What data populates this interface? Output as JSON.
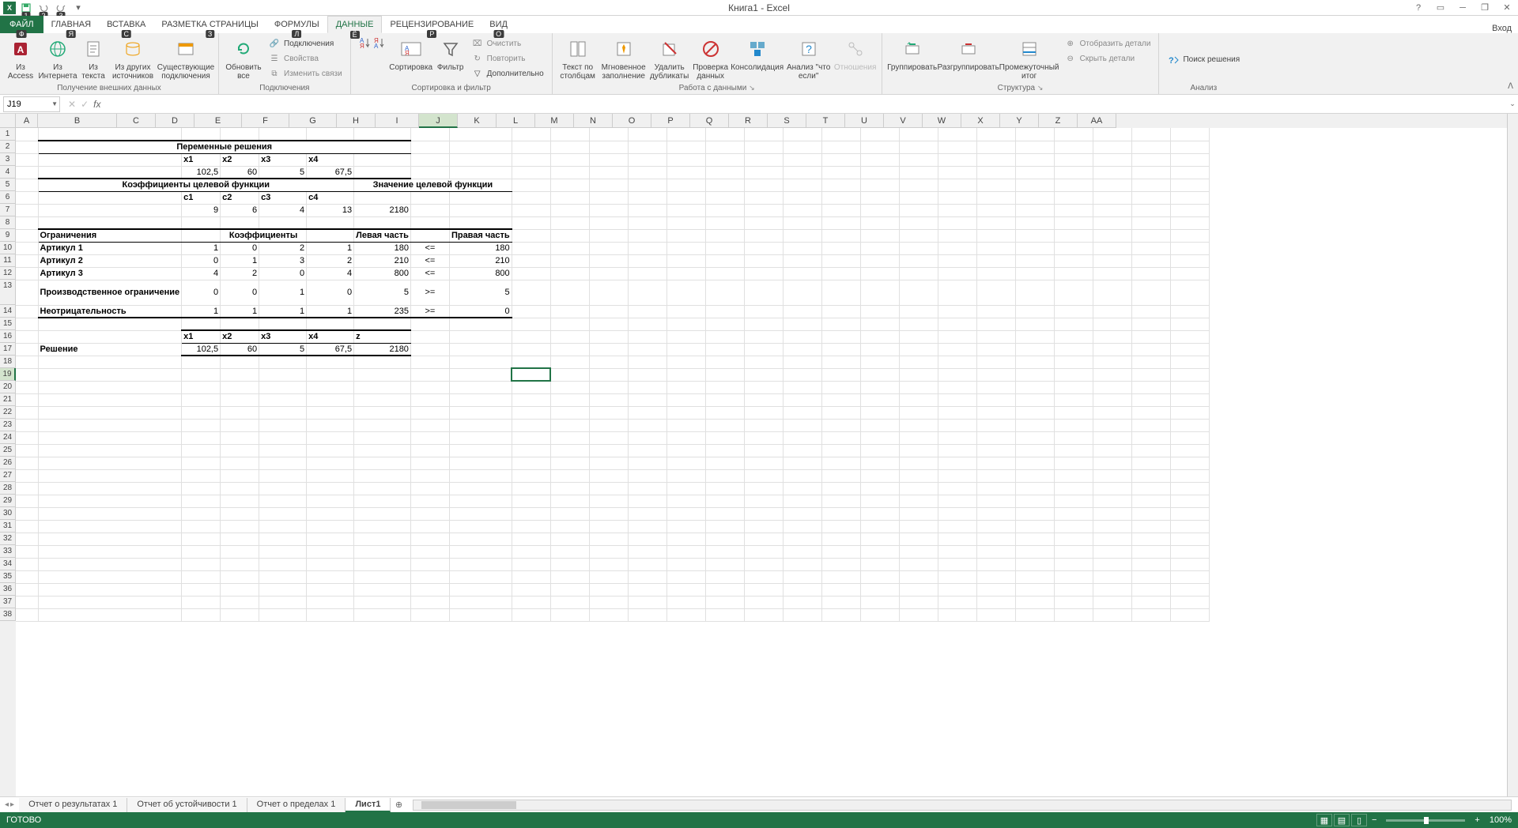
{
  "title": "Книга1 - Excel",
  "account_label": "Вход",
  "ribbon_tabs": {
    "file": "ФАЙЛ",
    "home": "ГЛАВНАЯ",
    "insert": "ВСТАВКА",
    "layout": "РАЗМЕТКА СТРАНИЦЫ",
    "formulas": "ФОРМУЛЫ",
    "data": "ДАННЫЕ",
    "review": "РЕЦЕНЗИРОВАНИЕ",
    "view": "ВИД"
  },
  "tab_keys": {
    "file": "Ф",
    "home": "Я",
    "insert": "С",
    "layout": "З",
    "formulas": "Л",
    "data": "Ё",
    "review": "Р",
    "view": "О"
  },
  "qat_keys": [
    "1",
    "2",
    "3"
  ],
  "ribbon": {
    "ext_data": {
      "access": "Из Access",
      "web": "Из Интернета",
      "text": "Из текста",
      "other": "Из других источников",
      "existing": "Существующие подключения",
      "label": "Получение внешних данных"
    },
    "connections": {
      "refresh": "Обновить все",
      "conn": "Подключения",
      "props": "Свойства",
      "edit": "Изменить связи",
      "label": "Подключения"
    },
    "sort_filter": {
      "sort": "Сортировка",
      "filter": "Фильтр",
      "clear": "Очистить",
      "reapply": "Повторить",
      "advanced": "Дополнительно",
      "label": "Сортировка и фильтр"
    },
    "tools": {
      "text_cols": "Текст по столбцам",
      "flash": "Мгновенное заполнение",
      "dup": "Удалить дубликаты",
      "valid": "Проверка данных",
      "consol": "Консолидация",
      "whatif": "Анализ \"что если\"",
      "rel": "Отношения",
      "label": "Работа с данными"
    },
    "outline": {
      "group": "Группировать",
      "ungroup": "Разгруппировать",
      "subtotal": "Промежуточный итог",
      "show": "Отобразить детали",
      "hide": "Скрыть детали",
      "label": "Структура"
    },
    "analysis": {
      "solver": "Поиск решения",
      "label": "Анализ"
    }
  },
  "name_box": "J19",
  "columns": [
    "A",
    "B",
    "C",
    "D",
    "E",
    "F",
    "G",
    "H",
    "I",
    "J",
    "K",
    "L",
    "M",
    "N",
    "O",
    "P",
    "Q",
    "R",
    "S",
    "T",
    "U",
    "V",
    "W",
    "X",
    "Y",
    "Z",
    "AA"
  ],
  "selected_col": "J",
  "selected_row": 19,
  "total_rows": 38,
  "sheet_data": {
    "title1": "Переменные решения",
    "x_headers": [
      "x1",
      "x2",
      "x3",
      "x4"
    ],
    "x_values": [
      "102,5",
      "60",
      "5",
      "67,5"
    ],
    "title2": "Коэффициенты целевой функции",
    "title3": "Значение целевой функции",
    "c_headers": [
      "c1",
      "c2",
      "c3",
      "c4"
    ],
    "c_values": [
      "9",
      "6",
      "4",
      "13"
    ],
    "obj_value": "2180",
    "constraints_title": "Ограничения",
    "coeff_title": "Коэффициенты",
    "left_title": "Левая часть",
    "right_title": "Правая часть",
    "rows": [
      {
        "name": "Артикул 1",
        "c": [
          "1",
          "0",
          "2",
          "1"
        ],
        "left": "180",
        "op": "<=",
        "right": "180"
      },
      {
        "name": "Артикул 2",
        "c": [
          "0",
          "1",
          "3",
          "2"
        ],
        "left": "210",
        "op": "<=",
        "right": "210"
      },
      {
        "name": "Артикул 3",
        "c": [
          "4",
          "2",
          "0",
          "4"
        ],
        "left": "800",
        "op": "<=",
        "right": "800"
      },
      {
        "name": "Производственное ограничение",
        "c": [
          "0",
          "0",
          "1",
          "0"
        ],
        "left": "5",
        "op": ">=",
        "right": "5"
      },
      {
        "name": "Неотрицательность",
        "c": [
          "1",
          "1",
          "1",
          "1"
        ],
        "left": "235",
        "op": ">=",
        "right": "0"
      }
    ],
    "sol_title": "Решение",
    "sol_headers": [
      "x1",
      "x2",
      "x3",
      "x4",
      "z"
    ],
    "sol_values": [
      "102,5",
      "60",
      "5",
      "67,5",
      "2180"
    ]
  },
  "sheets": [
    "Отчет о результатах 1",
    "Отчет об устойчивости 1",
    "Отчет о пределах 1",
    "Лист1"
  ],
  "active_sheet": 3,
  "status_text": "ГОТОВО",
  "zoom": "100%"
}
